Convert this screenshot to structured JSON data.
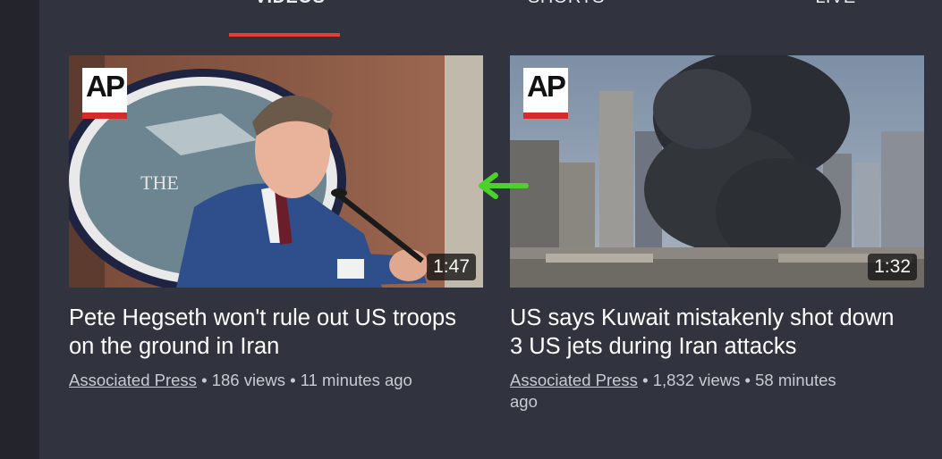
{
  "tabs": [
    {
      "label": "VIDEOS",
      "active": true
    },
    {
      "label": "SHORTS",
      "active": false
    },
    {
      "label": "LIVE",
      "active": false
    }
  ],
  "colors": {
    "background": "#31333f",
    "tab_underline": "#e63d30",
    "arrow": "#4cd12a",
    "logo_red": "#d52b2b"
  },
  "videos": [
    {
      "badge": "AP",
      "duration": "1:47",
      "title": "Pete Hegseth won't rule out US troops on the ground in Iran",
      "source": "Associated Press",
      "stats": " • 186 views • 11 minutes ago"
    },
    {
      "badge": "AP",
      "duration": "1:32",
      "title": "US says Kuwait mistakenly shot down 3 US jets during Iran attacks",
      "source": "Associated Press",
      "stats": " • 1,832 views • 58 minutes ago"
    }
  ],
  "annotation": {
    "icon": "left-arrow-icon"
  }
}
